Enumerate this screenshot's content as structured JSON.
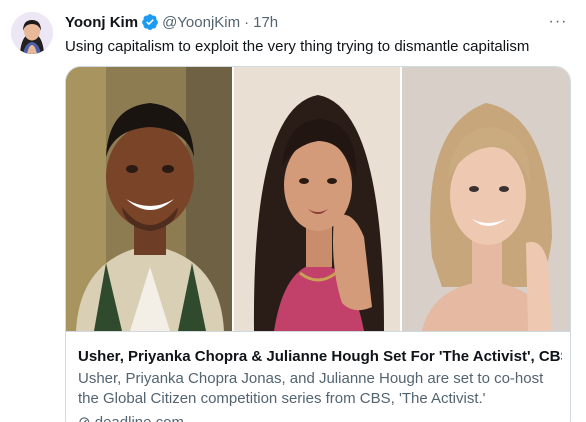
{
  "tweet": {
    "display_name": "Yoonj Kim",
    "handle": "@YoonjKim",
    "separator": "·",
    "time": "17h",
    "text": "Using capitalism to exploit the very thing trying to dismantle capitalism",
    "more_label": "···"
  },
  "card": {
    "title": "Usher, Priyanka Chopra & Julianne Hough Set For 'The Activist', CBS ...",
    "description": "Usher, Priyanka Chopra Jonas, and Julianne Hough are set to co-host the Global Citizen competition series from CBS, 'The Activist.'",
    "domain": "⊘ deadline.com"
  },
  "colors": {
    "name": "#0f1419",
    "secondary": "#536471",
    "verified": "#1d9bf0",
    "border": "#cfd9de"
  },
  "icons": {
    "verified": "verified-badge-icon",
    "more": "more-horizontal-icon"
  }
}
